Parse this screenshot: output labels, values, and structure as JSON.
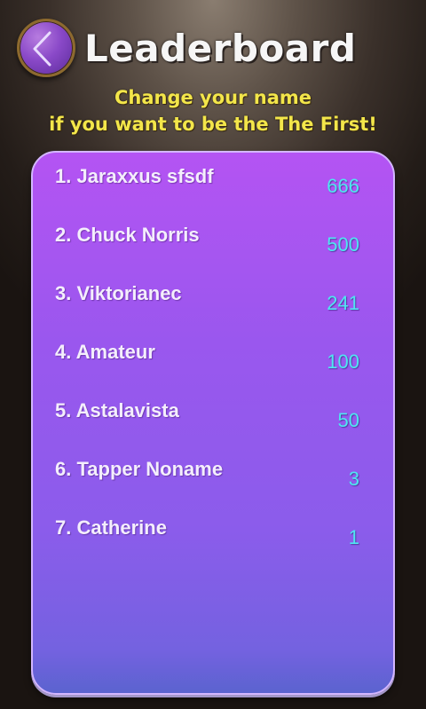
{
  "header": {
    "title": "Leaderboard",
    "back_icon": "chevron-left-icon"
  },
  "subtitle": {
    "line1": "Change your name",
    "line2": "if you want to be the The First!"
  },
  "leaderboard": {
    "entries": [
      {
        "label": "1. Jaraxxus sfsdf",
        "score": "666"
      },
      {
        "label": "2. Chuck Norris",
        "score": "500"
      },
      {
        "label": "3. Viktorianec",
        "score": "241"
      },
      {
        "label": "4. Amateur",
        "score": "100"
      },
      {
        "label": "5. Astalavista",
        "score": "50"
      },
      {
        "label": "6. Tapper Noname",
        "score": "3"
      },
      {
        "label": "7. Catherine",
        "score": "1"
      }
    ]
  },
  "colors": {
    "title": "#f6f6f6",
    "subtitle": "#f3e64a",
    "panel_top": "#b454f3",
    "panel_bottom": "#5b63cf",
    "name": "#f4eefc",
    "score": "#4fe6f0"
  }
}
